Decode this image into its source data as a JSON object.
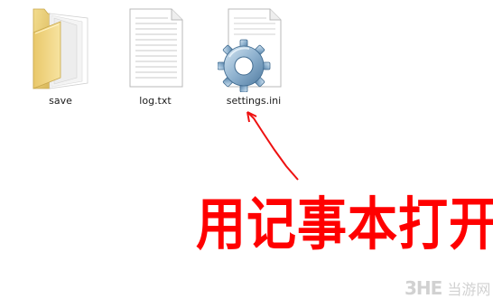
{
  "files": [
    {
      "name": "save",
      "icon": "folder-icon"
    },
    {
      "name": "log.txt",
      "icon": "text-file-icon"
    },
    {
      "name": "settings.ini",
      "icon": "settings-gear-icon"
    }
  ],
  "annotation": {
    "text": "用记事本打开",
    "color": "#ff0000"
  },
  "watermark": {
    "logo": "3HE",
    "text": "当游网"
  }
}
